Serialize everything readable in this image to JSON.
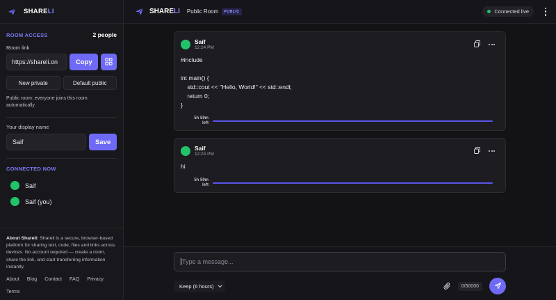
{
  "brand": {
    "name_main": "SHARE",
    "name_accent": "LI"
  },
  "sidebar": {
    "room_access_label": "ROOM ACCESS",
    "people_count": "2 people",
    "room_link_label": "Room link",
    "room_link_value": "https://shareli.on",
    "copy_label": "Copy",
    "new_private_label": "New private",
    "default_public_label": "Default public",
    "room_note": "Public room: everyone joins this room automatically.",
    "display_name_label": "Your display name",
    "display_name_value": "Saif",
    "save_label": "Save",
    "connected_label": "CONNECTED NOW",
    "users": [
      {
        "name": "Saif"
      },
      {
        "name": "Saif (you)"
      }
    ],
    "about_title": "About Shareli:",
    "about_text": " Shareli is a secure, browser-based platform for sharing text, code, files and links across devices. No account required — create a room, share the link, and start transferring information instantly.",
    "footer_links": [
      "About",
      "Blog",
      "Contact",
      "FAQ",
      "Privacy",
      "Terms"
    ]
  },
  "topbar": {
    "room_title": "Public Room",
    "badge": "PUBLIC",
    "status": "Connected live"
  },
  "messages": [
    {
      "author": "Saif",
      "time": "12:24 PM",
      "body": "#include\n\nint main() {\n    std::cout << \"Hello, World!\" << std::endl;\n    return 0;\n}",
      "expiry_line1": "5h 59m",
      "expiry_line2": "left",
      "remaining_fraction": 0.998
    },
    {
      "author": "Saif",
      "time": "12:24 PM",
      "body": "hi",
      "expiry_line1": "5h 59m",
      "expiry_line2": "left",
      "remaining_fraction": 0.998
    }
  ],
  "composer": {
    "placeholder": "Type a message...",
    "keep_label": "Keep (6 hours)",
    "char_count": "0/50000"
  },
  "colors": {
    "accent": "#6f6af5",
    "online": "#22c36a",
    "background": "#131316"
  }
}
